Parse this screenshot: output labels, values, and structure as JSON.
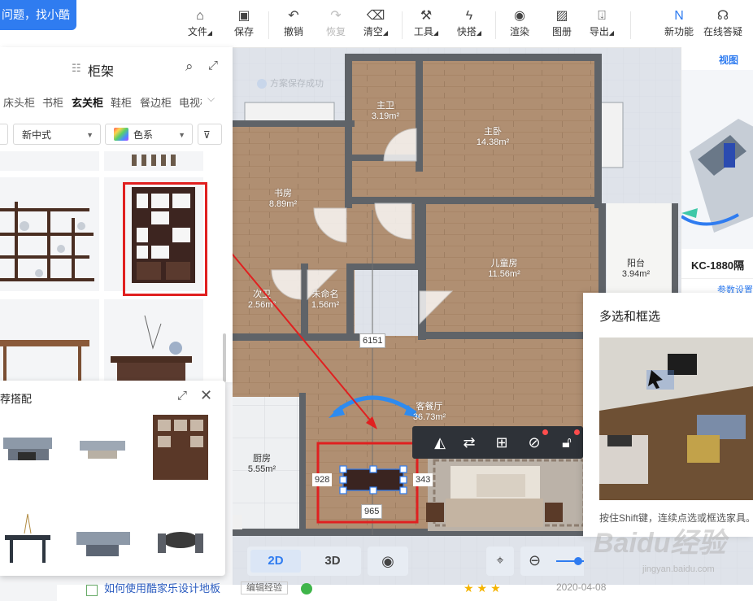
{
  "help_pill": "问题，找小酷",
  "toolbar": {
    "file": "文件",
    "save": "保存",
    "undo": "撤销",
    "redo": "恢复",
    "clear": "清空",
    "tools": "工具",
    "quick": "快搭",
    "render": "渲染",
    "album": "图册",
    "export": "导出",
    "new_feature": "新功能",
    "online_help": "在线答疑"
  },
  "catalog": {
    "title": "柜架",
    "tabs": [
      "床头柜",
      "书柜",
      "玄关柜",
      "鞋柜",
      "餐边柜",
      "电视柜"
    ],
    "active_tab": "玄关柜",
    "style_filter": "新中式",
    "color_filter": "色系"
  },
  "recommend": {
    "title": "荐搭配"
  },
  "rooms": {
    "master_bath": {
      "name": "主卫",
      "area": "3.19m²"
    },
    "master_bed": {
      "name": "主卧",
      "area": "14.38m²"
    },
    "study": {
      "name": "书房",
      "area": "8.89m²"
    },
    "kids_room": {
      "name": "儿童房",
      "area": "11.56m²"
    },
    "balcony": {
      "name": "阳台",
      "area": "3.94m²"
    },
    "second_bath": {
      "name": "次卫",
      "area": "2.56m²"
    },
    "unnamed": {
      "name": "未命名",
      "area": "1.56m²"
    },
    "living": {
      "name": "客餐厅",
      "area": "36.73m²"
    },
    "kitchen": {
      "name": "厨房",
      "area": "5.55m²"
    }
  },
  "dimensions": {
    "vertical": "6151",
    "left_gap": "928",
    "right_gap": "343",
    "width": "965"
  },
  "canvas_toast": "方案保存成功",
  "view_card": {
    "tab": "视图",
    "product_name": "KC-1880隔",
    "link": "参数设置"
  },
  "tip_card": {
    "title": "多选和框选",
    "desc": "按住Shift键，连续点选或框选家具。"
  },
  "view_mode": {
    "mode_2d": "2D",
    "mode_3d": "3D",
    "active": "2D"
  },
  "status": {
    "text": "如何使用酷家乐设计地板",
    "badge": "编辑经验",
    "date": "2020-04-08",
    "rating": 3
  },
  "watermark": "Baidu经验",
  "watermark_sub": "jingyan.baidu.com",
  "colors": {
    "accent": "#2f7cf0",
    "highlight": "#e02020",
    "wall": "#5f6368",
    "floor": "#b09073"
  }
}
